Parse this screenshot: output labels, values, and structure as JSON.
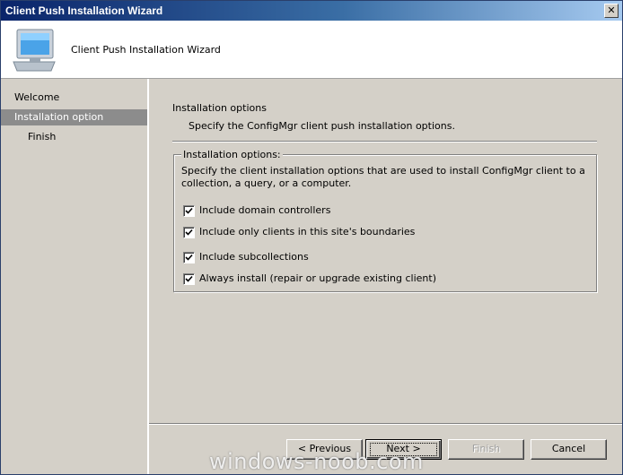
{
  "window": {
    "title": "Client Push Installation Wizard",
    "close_glyph": "✕"
  },
  "banner": {
    "title": "Client Push Installation Wizard",
    "icon": "computer-monitor-icon"
  },
  "nav": {
    "items": [
      {
        "label": "Welcome",
        "selected": false
      },
      {
        "label": "Installation option",
        "selected": true
      },
      {
        "label": "Finish",
        "selected": false
      }
    ]
  },
  "page": {
    "heading": "Installation options",
    "subheading": "Specify the ConfigMgr client push installation options."
  },
  "group": {
    "legend": "Installation options:",
    "description": "Specify the client installation options that are used to install ConfigMgr client to a collection, a query, or a computer.",
    "options": [
      {
        "label": "Include domain controllers",
        "checked": true
      },
      {
        "label": "Include only clients in this site's boundaries",
        "checked": true
      },
      {
        "label": "Include subcollections",
        "checked": true
      },
      {
        "label": "Always install (repair or upgrade existing client)",
        "checked": true
      }
    ]
  },
  "buttons": {
    "previous": "< Previous",
    "next": "Next >",
    "finish": "Finish",
    "cancel": "Cancel"
  },
  "watermark": "windows-noob.com"
}
